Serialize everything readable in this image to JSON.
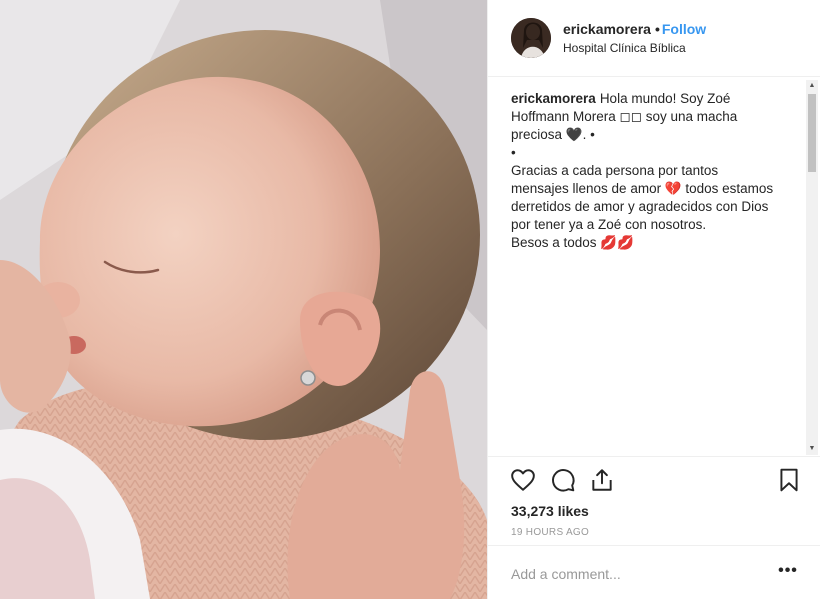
{
  "post": {
    "author": {
      "username": "erickamorera",
      "follow_label": "Follow",
      "separator": "•",
      "location": "Hospital Clínica Bíblica"
    },
    "caption": {
      "author": "erickamorera",
      "lines": [
        "Hola mundo! Soy Zoé",
        "Hoffmann Morera ◻◻ soy una macha",
        "preciosa 🖤. •",
        "•",
        "Gracias a cada persona por tantos",
        "mensajes llenos de amor 💔 todos estamos",
        "derretidos de amor y agradecidos con Dios",
        "por tener ya a Zoé con nosotros.",
        "Besos a todos 💋💋"
      ]
    },
    "likes": "33,273 likes",
    "timestamp": "19 HOURS AGO",
    "comment": {
      "placeholder": "Add a comment...",
      "value": ""
    },
    "more_label": "•••"
  },
  "icons": {
    "like": "heart-icon",
    "comment": "comment-icon",
    "share": "share-icon",
    "save": "bookmark-icon",
    "more": "more-options-icon"
  },
  "colors": {
    "follow": "#3897f0",
    "text": "#262626",
    "muted": "#999999",
    "divider": "#efefef"
  }
}
